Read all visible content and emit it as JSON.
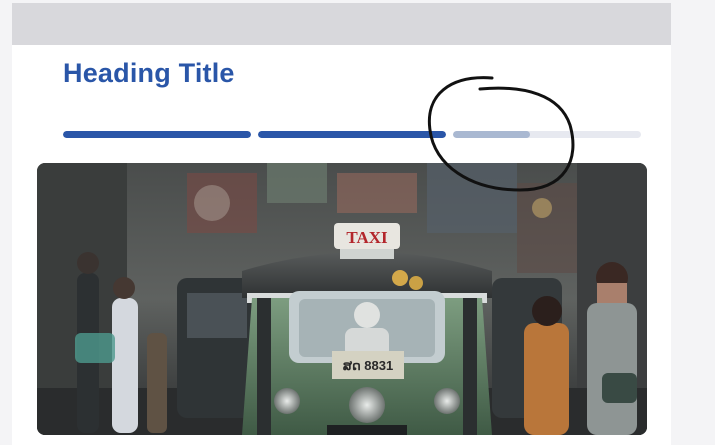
{
  "header": {
    "title": "Heading Title"
  },
  "progress": {
    "segments": [
      {
        "fill": 1.0,
        "state": "complete"
      },
      {
        "fill": 1.0,
        "state": "complete"
      },
      {
        "fill": 0.41,
        "state": "in-progress"
      }
    ],
    "colors": {
      "complete": "#2a56a8",
      "in_progress": "#a9b8d1",
      "track": "#e7e9f0"
    }
  },
  "hero_image": {
    "sign_text": "TAXI",
    "plate_text": "ສດ 8831"
  },
  "annotation": {
    "type": "hand-drawn-circle",
    "color": "#111111"
  }
}
